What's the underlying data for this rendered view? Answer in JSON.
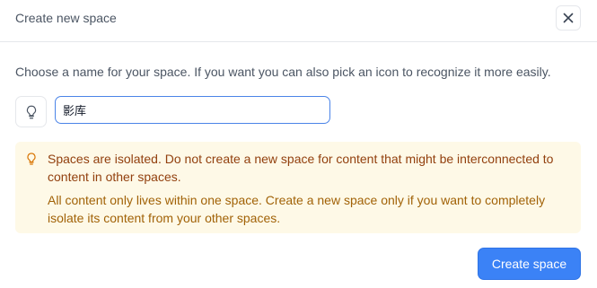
{
  "dialog": {
    "title": "Create new space",
    "close_icon": "close-icon",
    "intro_text": "Choose a name for your space. If you want you can also pick an icon to recognize it more easily.",
    "icon_picker_icon": "lightbulb-icon",
    "name_input_value": "影库",
    "notice": {
      "icon": "lightbulb-icon",
      "strong_text": "Spaces are isolated. Do not create a new space for content that might be interconnected to content in other spaces.",
      "body_text": "All content only lives within one space. Create a new space only if you want to completely isolate its content from your other spaces."
    },
    "create_button_label": "Create space"
  },
  "colors": {
    "accent": "#3b82f6",
    "notice_bg": "#fef9e7",
    "notice_text": "#92400e"
  }
}
